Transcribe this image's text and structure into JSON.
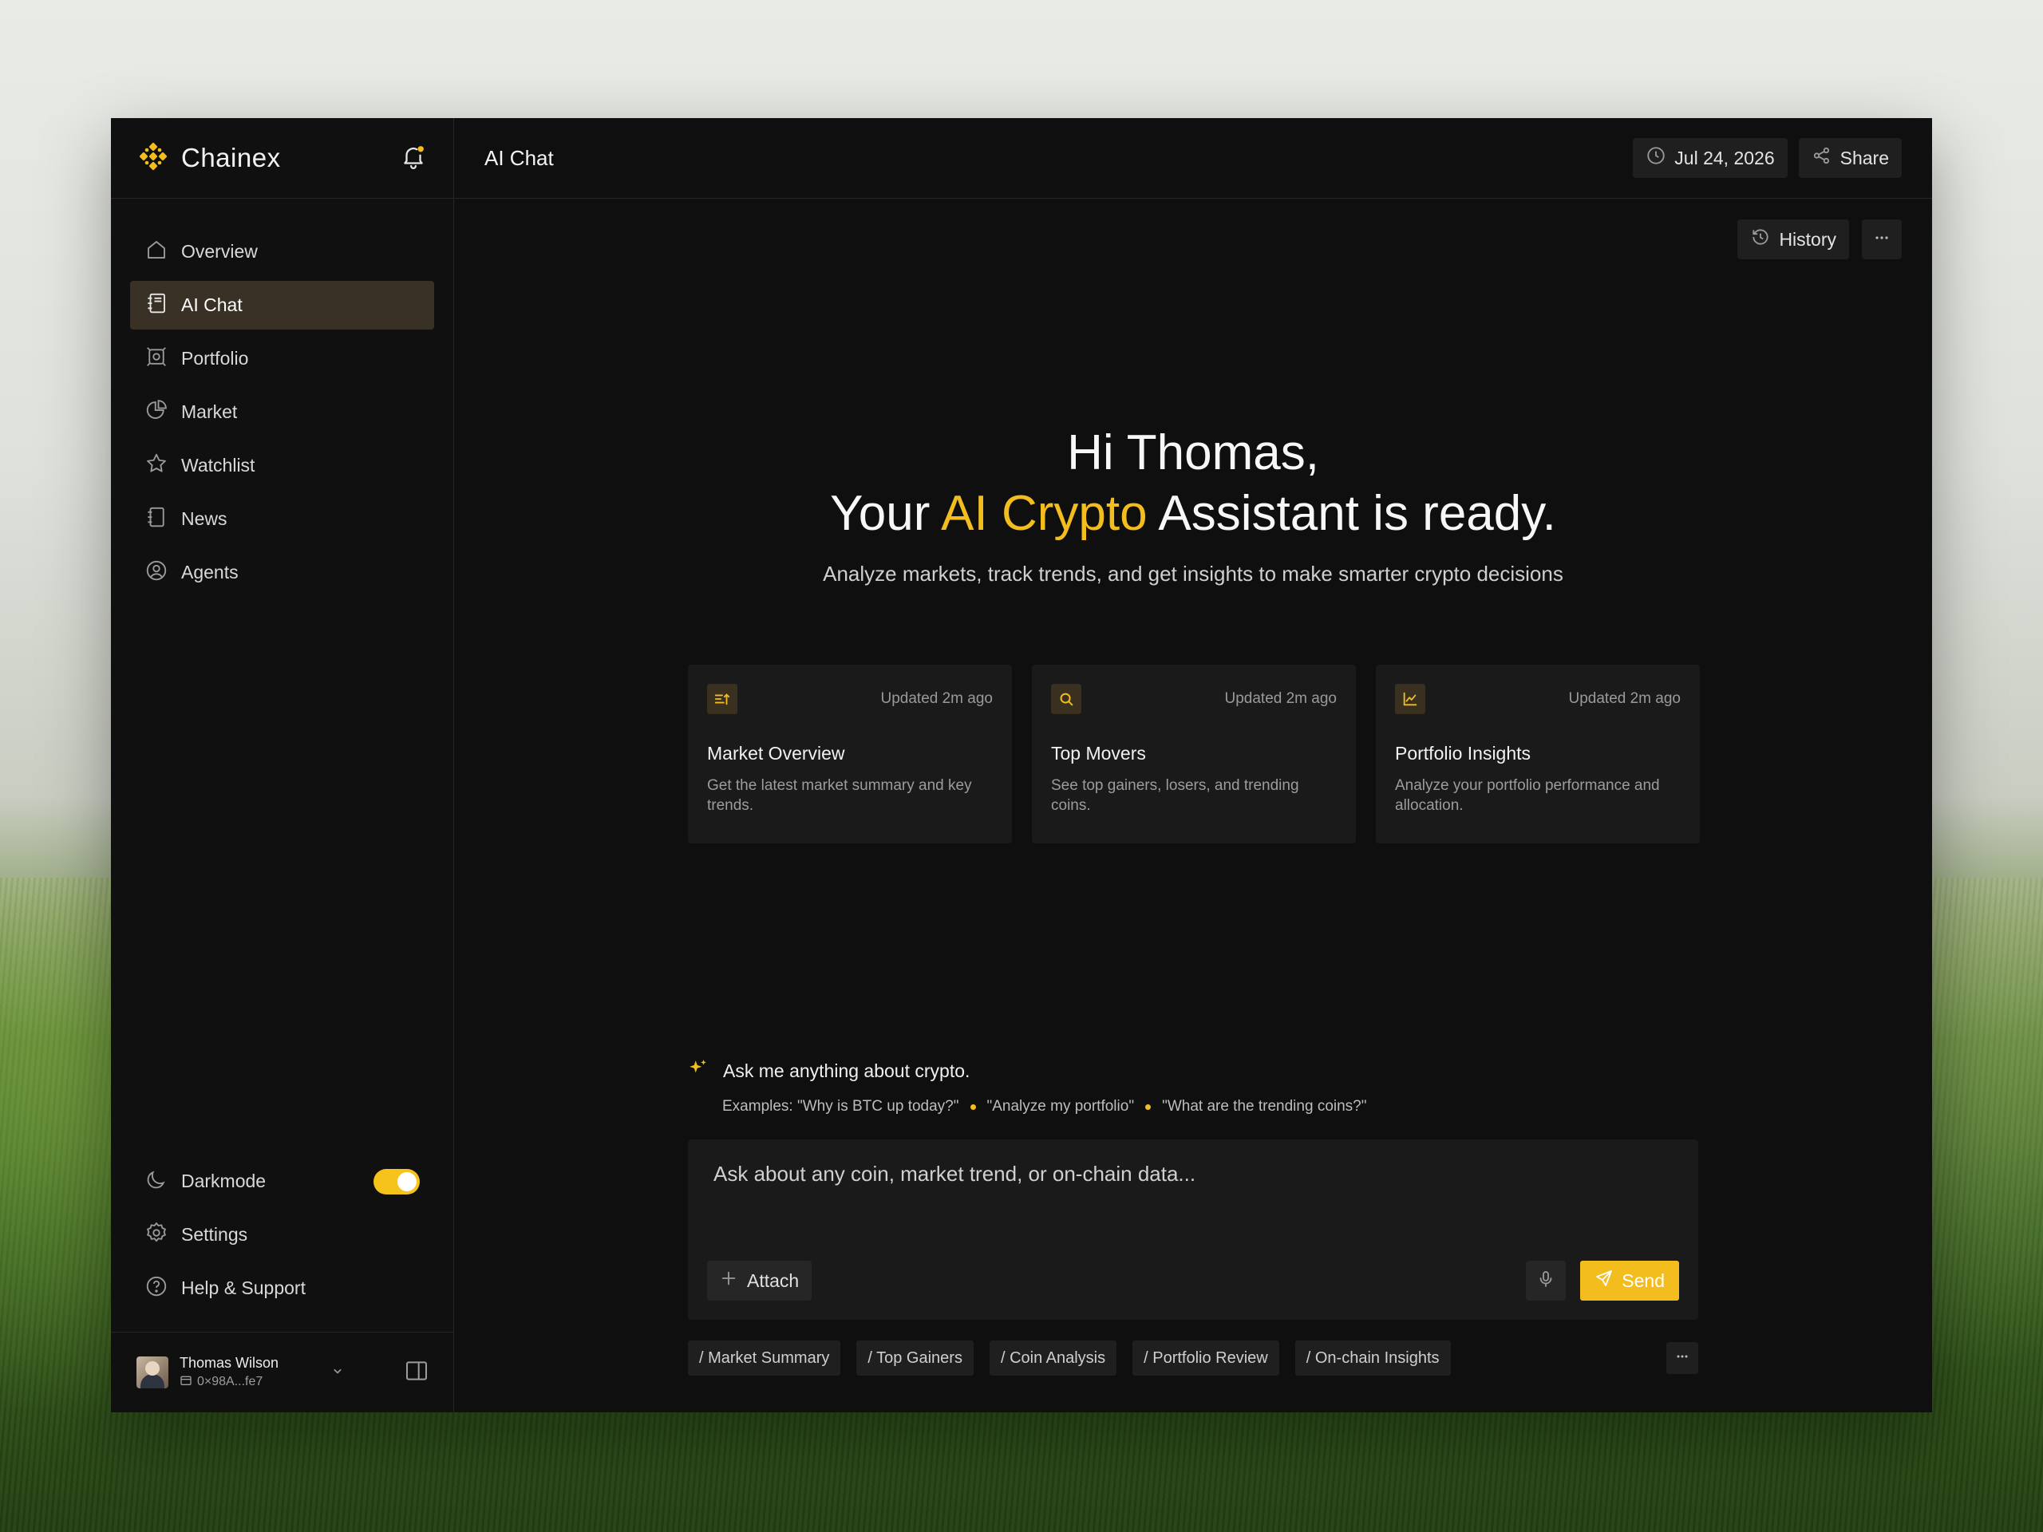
{
  "brand": {
    "name": "Chainex"
  },
  "sidebar": {
    "items": [
      {
        "label": "Overview",
        "icon": "home-icon",
        "active": false
      },
      {
        "label": "AI Chat",
        "icon": "notebook-icon",
        "active": true
      },
      {
        "label": "Portfolio",
        "icon": "portfolio-icon",
        "active": false
      },
      {
        "label": "Market",
        "icon": "pie-chart-icon",
        "active": false
      },
      {
        "label": "Watchlist",
        "icon": "star-icon",
        "active": false
      },
      {
        "label": "News",
        "icon": "news-icon",
        "active": false
      },
      {
        "label": "Agents",
        "icon": "user-circle-icon",
        "active": false
      }
    ],
    "bottom": {
      "darkmode_label": "Darkmode",
      "darkmode_on": true,
      "settings_label": "Settings",
      "help_label": "Help & Support"
    },
    "user": {
      "name": "Thomas Wilson",
      "wallet": "0×98A...fe7"
    }
  },
  "topbar": {
    "title": "AI Chat",
    "date": "Jul 24, 2026",
    "share_label": "Share",
    "history_label": "History"
  },
  "hero": {
    "line1": "Hi Thomas,",
    "line2_pre": "Your ",
    "line2_accent": "AI Crypto",
    "line2_post": " Assistant is ready.",
    "subtitle": "Analyze markets, track trends, and get insights to make smarter crypto decisions"
  },
  "cards": [
    {
      "updated": "Updated 2m ago",
      "title": "Market Overview",
      "desc": "Get the latest market summary and key trends."
    },
    {
      "updated": "Updated 2m ago",
      "title": "Top Movers",
      "desc": "See top gainers, losers, and trending coins."
    },
    {
      "updated": "Updated 2m ago",
      "title": "Portfolio Insights",
      "desc": "Analyze your portfolio performance and allocation."
    }
  ],
  "ask": {
    "prompt": "Ask me anything about crypto.",
    "examples_label": "Examples: \"Why is BTC up today?\"",
    "example2": "\"Analyze my portfolio\"",
    "example3": "\"What are the trending coins?\""
  },
  "composer": {
    "placeholder": "Ask about any coin, market trend, or on-chain data...",
    "attach_label": "Attach",
    "send_label": "Send"
  },
  "shortcuts": [
    "/ Market Summary",
    "/ Top Gainers",
    "/ Coin Analysis",
    "/ Portfolio Review",
    "/ On-chain Insights"
  ],
  "colors": {
    "accent": "#f2bd1d",
    "active_nav": "#3a3126",
    "background": "#0f0f0f",
    "card": "#1a1a1a"
  }
}
